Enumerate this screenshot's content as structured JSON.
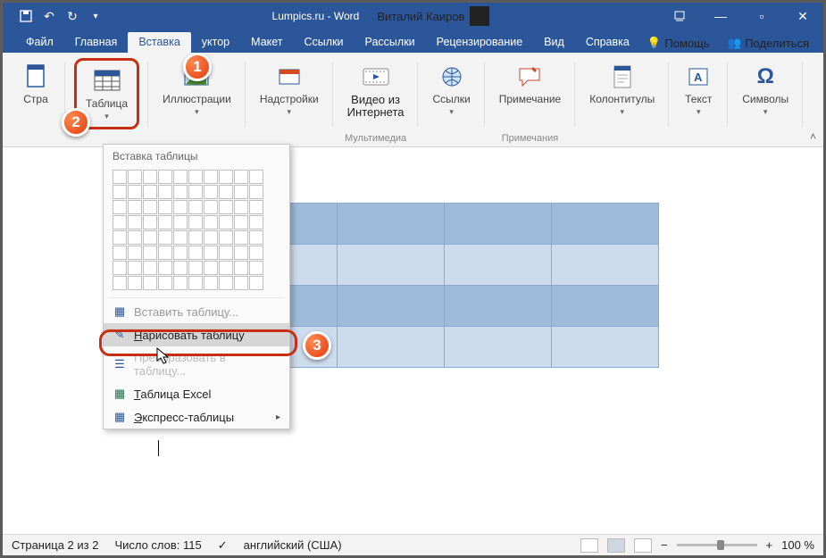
{
  "titlebar": {
    "document_title": "Lumpics.ru - Word",
    "user_name": "Виталий Каиров"
  },
  "tabs": {
    "file": "Файл",
    "home": "Главная",
    "insert": "Вставка",
    "design": "уктор",
    "layout": "Макет",
    "references": "Ссылки",
    "mailings": "Рассылки",
    "review": "Рецензирование",
    "view": "Вид",
    "help": "Справка",
    "tell_me": "Помощь",
    "share": "Поделиться"
  },
  "ribbon": {
    "pages": {
      "label": "Стра"
    },
    "table": {
      "label": "Таблица"
    },
    "illustrations": {
      "label": "Иллюстрации"
    },
    "addins": {
      "label": "Надстройки"
    },
    "video": {
      "label_line1": "Видео из",
      "label_line2": "Интернета",
      "group": "Мультимедиа"
    },
    "links": {
      "label": "Ссылки"
    },
    "comment": {
      "label": "Примечание",
      "group": "Примечания"
    },
    "headerfooter": {
      "label": "Колонтитулы"
    },
    "text": {
      "label": "Текст"
    },
    "symbols": {
      "label": "Символы"
    }
  },
  "dropdown": {
    "header": "Вставка таблицы",
    "insert_table": "Вставить таблицу...",
    "draw_table": "Нарисовать таблицу",
    "convert": "Преобразовать в таблицу...",
    "excel": "Таблица Excel",
    "quick": "Экспресс-таблицы"
  },
  "status": {
    "page": "Страница 2 из 2",
    "words": "Число слов: 115",
    "lang": "английский (США)",
    "zoom": "100 %"
  },
  "badges": {
    "one": "1",
    "two": "2",
    "three": "3"
  }
}
